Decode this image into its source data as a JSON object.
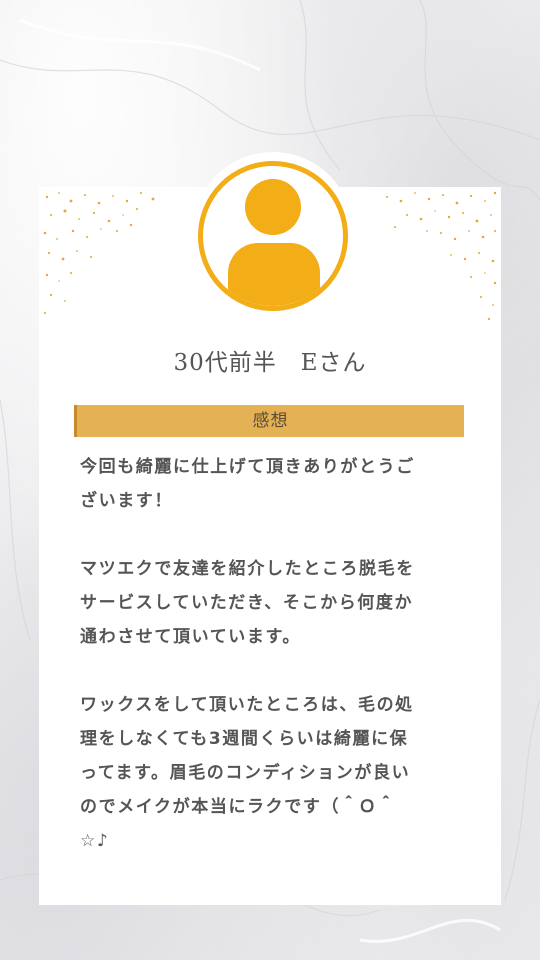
{
  "colors": {
    "accent": "#f2ad17",
    "section_bar": "#e4b155",
    "text": "#555555"
  },
  "avatar": {
    "icon": "user-avatar-icon"
  },
  "reviewer": {
    "name": "30代前半　Eさん"
  },
  "section": {
    "label": "感想"
  },
  "review": {
    "paragraphs": [
      "今回も綺麗に仕上げて頂きありがとうご\nざいます！",
      "マツエクで友達を紹介したところ脱毛を\nサービスしていただき、そこから何度か\n通わさせて頂いています。",
      "ワックスをして頂いたところは、毛の処\n理をしなくても3週間くらいは綺麗に保\nってます。眉毛のコンディションが良い\nのでメイクが本当にラクです（＾Ｏ＾\n☆♪"
    ]
  }
}
